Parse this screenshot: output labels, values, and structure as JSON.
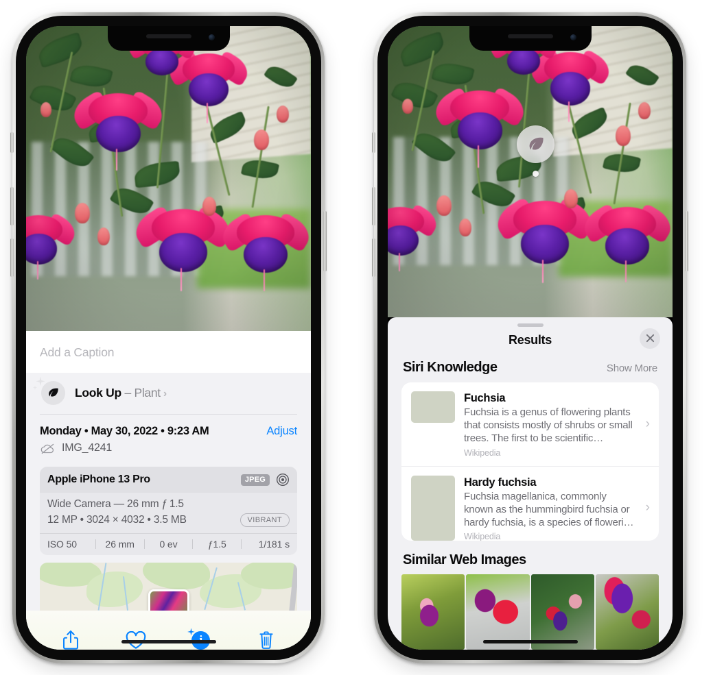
{
  "left_phone": {
    "name": "iphone-photos-info-view",
    "caption": {
      "placeholder": "Add a Caption",
      "value": ""
    },
    "lookup": {
      "icon": "leaf-icon",
      "label": "Look Up",
      "dash": " – ",
      "subject": "Plant",
      "chevron": "›"
    },
    "date": {
      "text": "Monday • May 30, 2022 • 9:23 AM",
      "adjust_label": "Adjust",
      "filename": "IMG_4241",
      "cloud_icon": "icloud-slash-icon"
    },
    "camera_card": {
      "device": "Apple iPhone 13 Pro",
      "format_tag": "JPEG",
      "aperture_icon": "aperture-icon",
      "lens_line": "Wide Camera — 26 mm ƒ 1.5",
      "specs_line": "12 MP • 3024 × 4032 • 3.5 MB",
      "style_tag": "VIBRANT",
      "exif": [
        "ISO 50",
        "26 mm",
        "0 ev",
        "ƒ1.5",
        "1/181 s"
      ]
    },
    "map": {
      "name": "location-map-strip",
      "pin_label": ""
    },
    "toolbar": {
      "share": "share-icon",
      "favorite": "heart-icon",
      "info": "info-sparkle-icon",
      "delete": "trash-icon"
    }
  },
  "right_phone": {
    "name": "iphone-visual-lookup-results",
    "badge": {
      "icon": "leaf-icon",
      "name": "visual-look-up-badge"
    },
    "sheet": {
      "title": "Results",
      "close_icon": "close-icon"
    },
    "siri_knowledge": {
      "section_title": "Siri Knowledge",
      "show_more": "Show More",
      "items": [
        {
          "title": "Fuchsia",
          "description": "Fuchsia is a genus of flowering plants that consists mostly of shrubs or small trees. The first to be scientific…",
          "source": "Wikipedia",
          "chevron": "›"
        },
        {
          "title": "Hardy fuchsia",
          "description": "Fuchsia magellanica, commonly known as the hummingbird fuchsia or hardy fuchsia, is a species of floweri…",
          "source": "Wikipedia",
          "chevron": "›"
        }
      ]
    },
    "similar_web_images": {
      "section_title": "Similar Web Images",
      "thumbnails": [
        "web-image-1",
        "web-image-2",
        "web-image-3",
        "web-image-4"
      ]
    }
  },
  "colors": {
    "accent_blue": "#0a84ff",
    "sheet_bg": "#f1f1f4",
    "card_bg": "#ffffff",
    "secondary_text": "#8a8a90"
  }
}
